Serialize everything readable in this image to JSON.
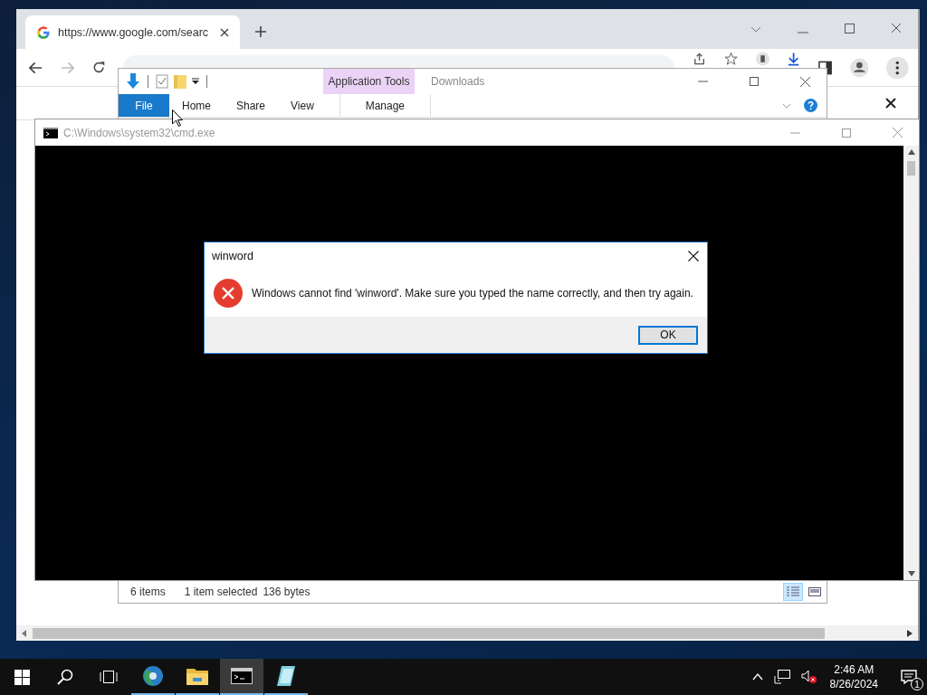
{
  "browser": {
    "tab_title": "https://www.google.com/searc"
  },
  "explorer": {
    "title": "Downloads",
    "context_group": "Application Tools",
    "ribbon_tabs": [
      {
        "label": "File",
        "kind": "file",
        "selected": false
      },
      {
        "label": "Home",
        "kind": "tab",
        "selected": false
      },
      {
        "label": "Share",
        "kind": "tab",
        "selected": false
      },
      {
        "label": "View",
        "kind": "tab",
        "selected": false
      },
      {
        "label": "Manage",
        "kind": "context",
        "selected": false
      }
    ],
    "status": {
      "items": "6 items",
      "selection": "1 item selected",
      "size": "136 bytes"
    },
    "view_buttons": [
      {
        "kind": "details",
        "selected": true
      },
      {
        "kind": "thumbnails",
        "selected": false
      }
    ]
  },
  "console": {
    "title": "C:\\Windows\\system32\\cmd.exe"
  },
  "dialog": {
    "title": "winword",
    "message": "Windows cannot find 'winword'. Make sure you typed the name correctly, and then try again.",
    "button": "OK"
  },
  "taskbar": {
    "apps": [
      {
        "kind": "browser",
        "active": false
      },
      {
        "kind": "folder",
        "active": false
      },
      {
        "kind": "console",
        "active": true
      },
      {
        "kind": "notepad",
        "active": false
      }
    ],
    "time": "2:46 AM",
    "date": "8/26/2024",
    "notification_count": "1"
  }
}
